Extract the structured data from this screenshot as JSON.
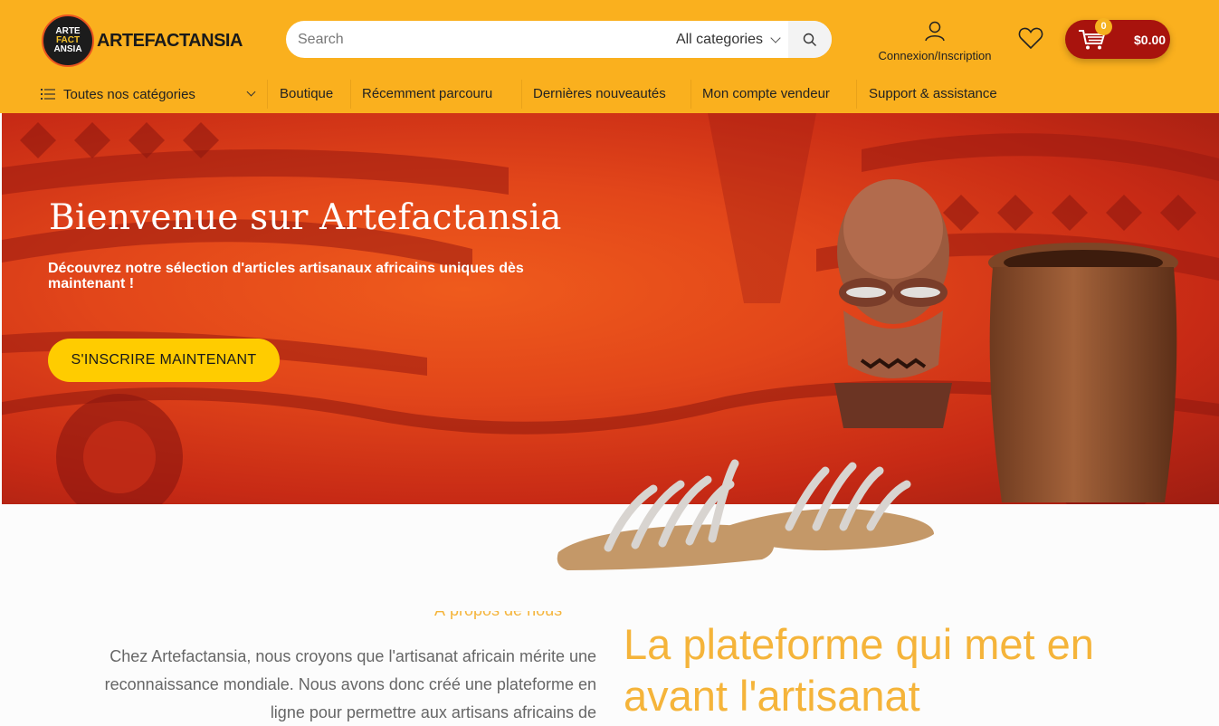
{
  "brand": {
    "logo_line1": "ARTE",
    "logo_line2": "FACT",
    "logo_line3": "ANSIA",
    "name": "ARTEFACTANSIA"
  },
  "search": {
    "placeholder": "Search",
    "category": "All categories"
  },
  "account": {
    "label": "Connexion/Inscription"
  },
  "cart": {
    "count": "0",
    "total": "$0.00"
  },
  "nav": {
    "all_categories": "Toutes nos catégories",
    "items": [
      "Boutique",
      "Récemment parcouru",
      "Dernières nouveautés",
      "Mon compte vendeur",
      "Support & assistance"
    ]
  },
  "hero": {
    "title": "Bienvenue sur Artefactansia",
    "subtitle": "Découvrez notre sélection d'articles artisanaux africains uniques dès maintenant !",
    "cta": "S'INSCRIRE MAINTENANT"
  },
  "about": {
    "kicker": "À propos de nous",
    "text": "Chez Artefactansia, nous croyons que l'artisanat africain mérite une reconnaissance mondiale. Nous avons donc créé une plateforme en ligne pour permettre aux artisans africains de",
    "title": "La plateforme qui met en avant l'artisanat"
  },
  "colors": {
    "header": "#fab01e",
    "cart": "#a8130d",
    "cta": "#ffcc00",
    "accent_text": "#f5b43a"
  }
}
